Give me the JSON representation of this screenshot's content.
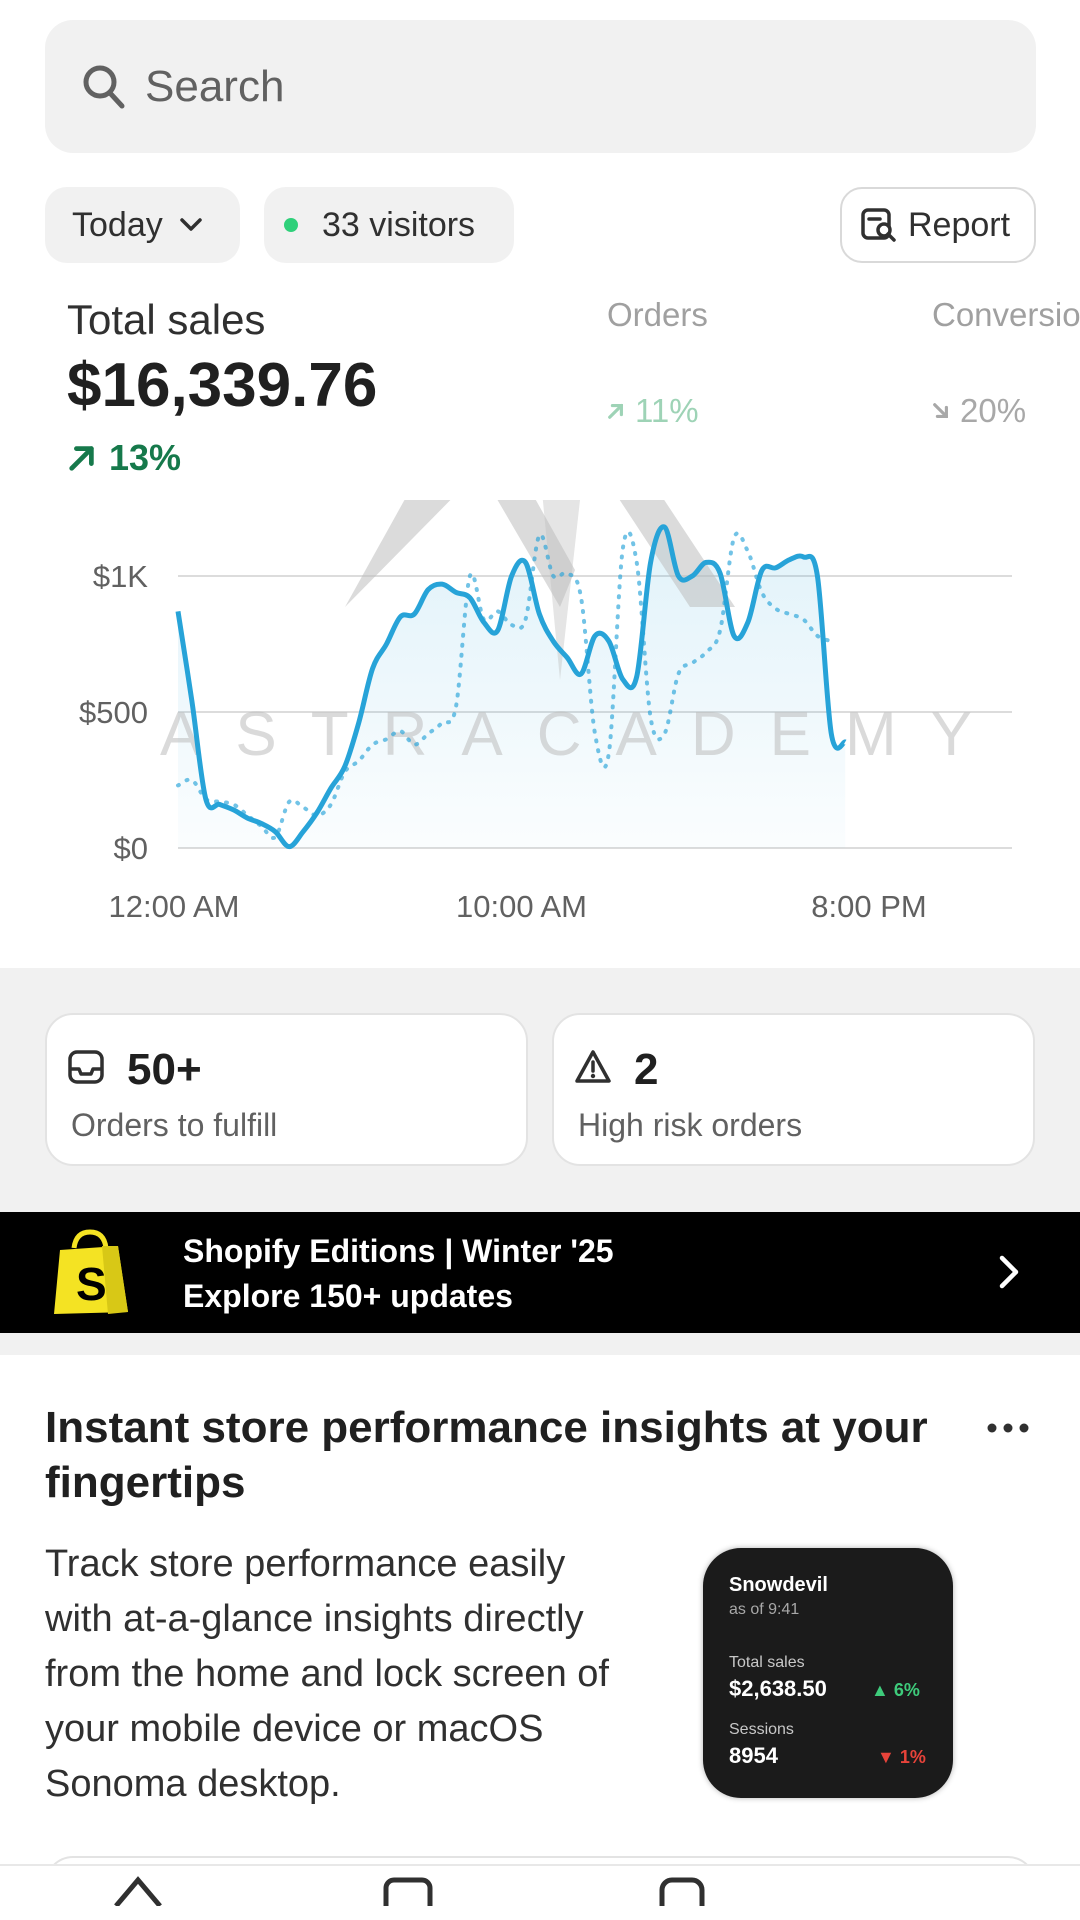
{
  "search": {
    "placeholder": "Search",
    "icon": "search-icon"
  },
  "filters": {
    "date_label": "Today",
    "visitors_label": "33 visitors",
    "report_label": "Report",
    "live_dot_color": "#2fd07a"
  },
  "metrics": {
    "total_sales": {
      "label": "Total sales",
      "value": "$16,339.76",
      "trend": "13%",
      "trend_dir": "up"
    },
    "orders": {
      "label": "Orders",
      "trend": "11%",
      "trend_dir": "up"
    },
    "conversion": {
      "label": "Conversio",
      "trend": "20%",
      "trend_dir": "down"
    }
  },
  "chart_data": {
    "type": "line",
    "y_ticks": [
      "$1K",
      "$500",
      "$0"
    ],
    "x_ticks": [
      "12:00 AM",
      "10:00 AM",
      "8:00 PM"
    ],
    "ylim": [
      0,
      1000
    ],
    "x_hours": [
      0,
      0.4,
      0.8,
      1.2,
      1.6,
      2.0,
      2.4,
      2.8,
      3.2,
      3.6,
      4.0,
      4.4,
      4.8,
      5.2,
      5.6,
      6.0,
      6.4,
      6.8,
      7.2,
      7.6,
      8.0,
      8.4,
      8.8,
      9.2,
      9.6,
      10.0,
      10.4,
      10.8,
      11.2,
      11.6,
      12.0,
      12.4,
      12.8,
      13.2,
      13.6,
      14.0,
      14.4,
      14.8,
      15.2,
      15.6,
      16.0,
      16.4,
      16.8,
      17.2,
      17.6,
      18.0,
      18.4,
      18.8,
      19.2,
      19.6,
      20.0,
      20.4,
      20.8,
      21.2,
      21.6,
      22.0,
      22.4,
      22.8,
      23.2
    ],
    "series": [
      {
        "values": [
          870,
          540,
          180,
          160,
          140,
          110,
          90,
          60,
          5,
          60,
          130,
          220,
          300,
          460,
          660,
          750,
          850,
          860,
          950,
          970,
          940,
          920,
          830,
          800,
          1000,
          1050,
          860,
          760,
          700,
          640,
          780,
          760,
          620,
          630,
          1050,
          1180,
          1000,
          1000,
          1050,
          1010,
          780,
          830,
          1020,
          1030,
          1060,
          1070,
          1000,
          420,
          390
        ],
        "style": "solid"
      },
      {
        "values": [
          230,
          250,
          180,
          170,
          160,
          120,
          80,
          40,
          170,
          150,
          120,
          160,
          280,
          320,
          380,
          400,
          430,
          380,
          420,
          460,
          520,
          1000,
          840,
          870,
          820,
          840,
          1150,
          1000,
          1010,
          920,
          420,
          350,
          1100,
          1050,
          480,
          420,
          640,
          680,
          720,
          800,
          1140,
          1090,
          940,
          880,
          860,
          840,
          780,
          760
        ],
        "style": "dotted"
      }
    ],
    "grid": true
  },
  "cards": [
    {
      "value": "50+",
      "label": "Orders to fulfill",
      "icon": "inbox-icon"
    },
    {
      "value": "2",
      "label": "High risk orders",
      "icon": "warning-icon"
    }
  ],
  "banner": {
    "line1": "Shopify Editions | Winter '25",
    "line2": "Explore 150+ updates",
    "icon": "shopify-bag-icon",
    "bag_color": "#f4e323"
  },
  "insights": {
    "title": "Instant store performance insights at your fingertips",
    "body": "Track store performance easily with at-a-glance insights directly from the home and lock screen of your mobile device or macOS Sonoma desktop.",
    "widget": {
      "store": "Snowdevil",
      "as_of": "as of 9:41",
      "sales_label": "Total sales",
      "sales_value": "$2,638.50",
      "sales_trend": "6%",
      "sessions_label": "Sessions",
      "sessions_value": "8954",
      "sessions_trend": "1%"
    }
  },
  "watermark": {
    "text": "ASTRACADEMY"
  },
  "colors": {
    "accent_line": "#27a3d8",
    "positive": "#16794b",
    "negative": "#e8433a"
  }
}
